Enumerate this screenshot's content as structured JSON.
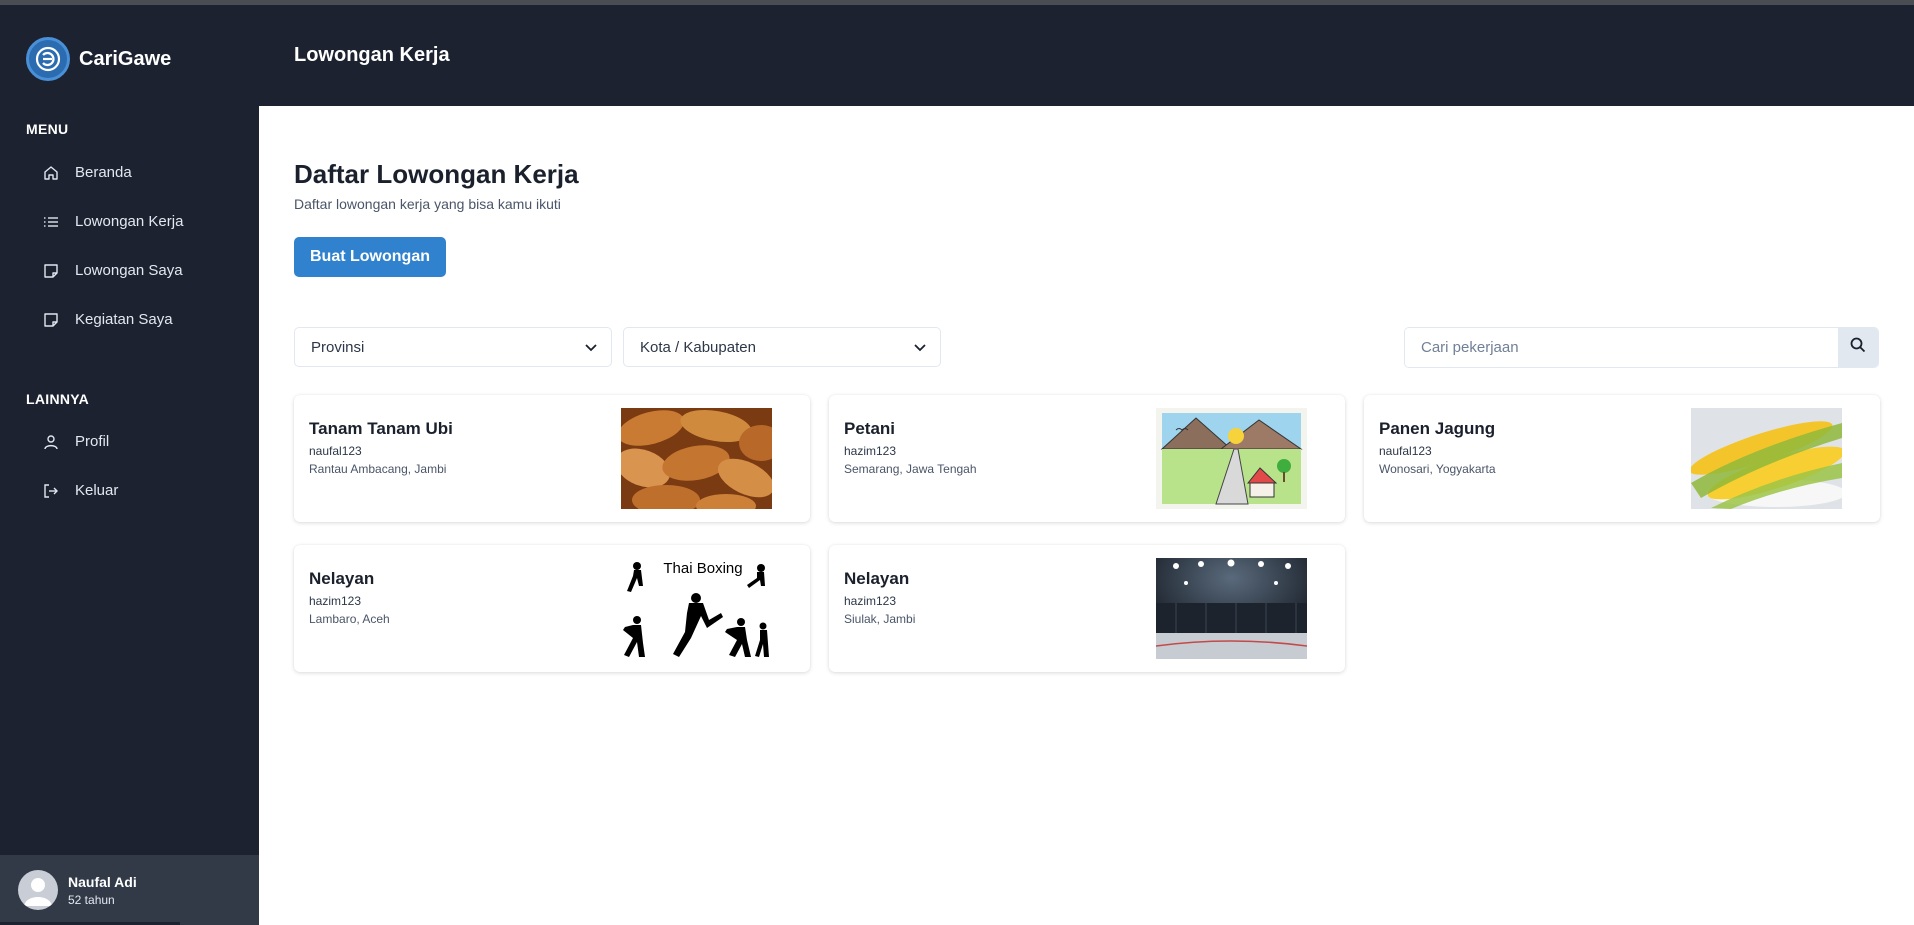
{
  "sidebar": {
    "brand": "CariGawe",
    "menu_title": "MENU",
    "menu_items": [
      {
        "label": "Beranda",
        "icon": "home-icon"
      },
      {
        "label": "Lowongan Kerja",
        "icon": "list-icon"
      },
      {
        "label": "Lowongan Saya",
        "icon": "note-icon"
      },
      {
        "label": "Kegiatan Saya",
        "icon": "note-icon"
      }
    ],
    "other_title": "LAINNYA",
    "other_items": [
      {
        "label": "Profil",
        "icon": "user-icon"
      },
      {
        "label": "Keluar",
        "icon": "logout-icon"
      }
    ],
    "user": {
      "name": "Naufal Adi",
      "age": "52 tahun"
    }
  },
  "header": {
    "title": "Lowongan Kerja"
  },
  "main": {
    "title": "Daftar Lowongan Kerja",
    "subtitle": "Daftar lowongan kerja yang bisa kamu ikuti",
    "create_button": "Buat Lowongan",
    "filters": {
      "province": "Provinsi",
      "city": "Kota / Kabupaten"
    },
    "search": {
      "placeholder": "Cari pekerjaan"
    }
  },
  "jobs": [
    {
      "title": "Tanam Tanam Ubi",
      "user": "naufal123",
      "location": "Rantau Ambacang, Jambi",
      "image": "sweet-potatoes"
    },
    {
      "title": "Petani",
      "user": "hazim123",
      "location": "Semarang, Jawa Tengah",
      "image": "farm-drawing"
    },
    {
      "title": "Panen Jagung",
      "user": "naufal123",
      "location": "Wonosari, Yogyakarta",
      "image": "corn"
    },
    {
      "title": "Nelayan",
      "user": "hazim123",
      "location": "Lambaro, Aceh",
      "image": "thai-boxing",
      "image_text": "Thai Boxing"
    },
    {
      "title": "Nelayan",
      "user": "hazim123",
      "location": "Siulak, Jambi",
      "image": "arena"
    }
  ],
  "colors": {
    "sidebar": "#1c2230",
    "accent": "#3182ce",
    "user_box": "#323a48"
  }
}
